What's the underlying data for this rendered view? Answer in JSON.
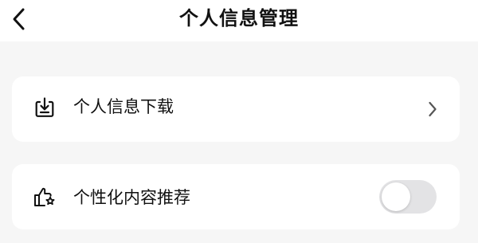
{
  "header": {
    "title": "个人信息管理",
    "back_icon": "chevron-left-icon"
  },
  "rows": [
    {
      "icon": "download-box-icon",
      "label": "个人信息下载",
      "trailing": "chevron-right-icon"
    },
    {
      "icon": "thumbs-up-star-icon",
      "label": "个性化内容推荐",
      "trailing": "toggle",
      "toggle_on": false
    }
  ],
  "colors": {
    "page_background": "#f6f6f6",
    "card_background": "#ffffff",
    "text": "#111111",
    "chevron": "#555555",
    "toggle_off_track": "#e3e3e5",
    "toggle_knob": "#ffffff"
  }
}
